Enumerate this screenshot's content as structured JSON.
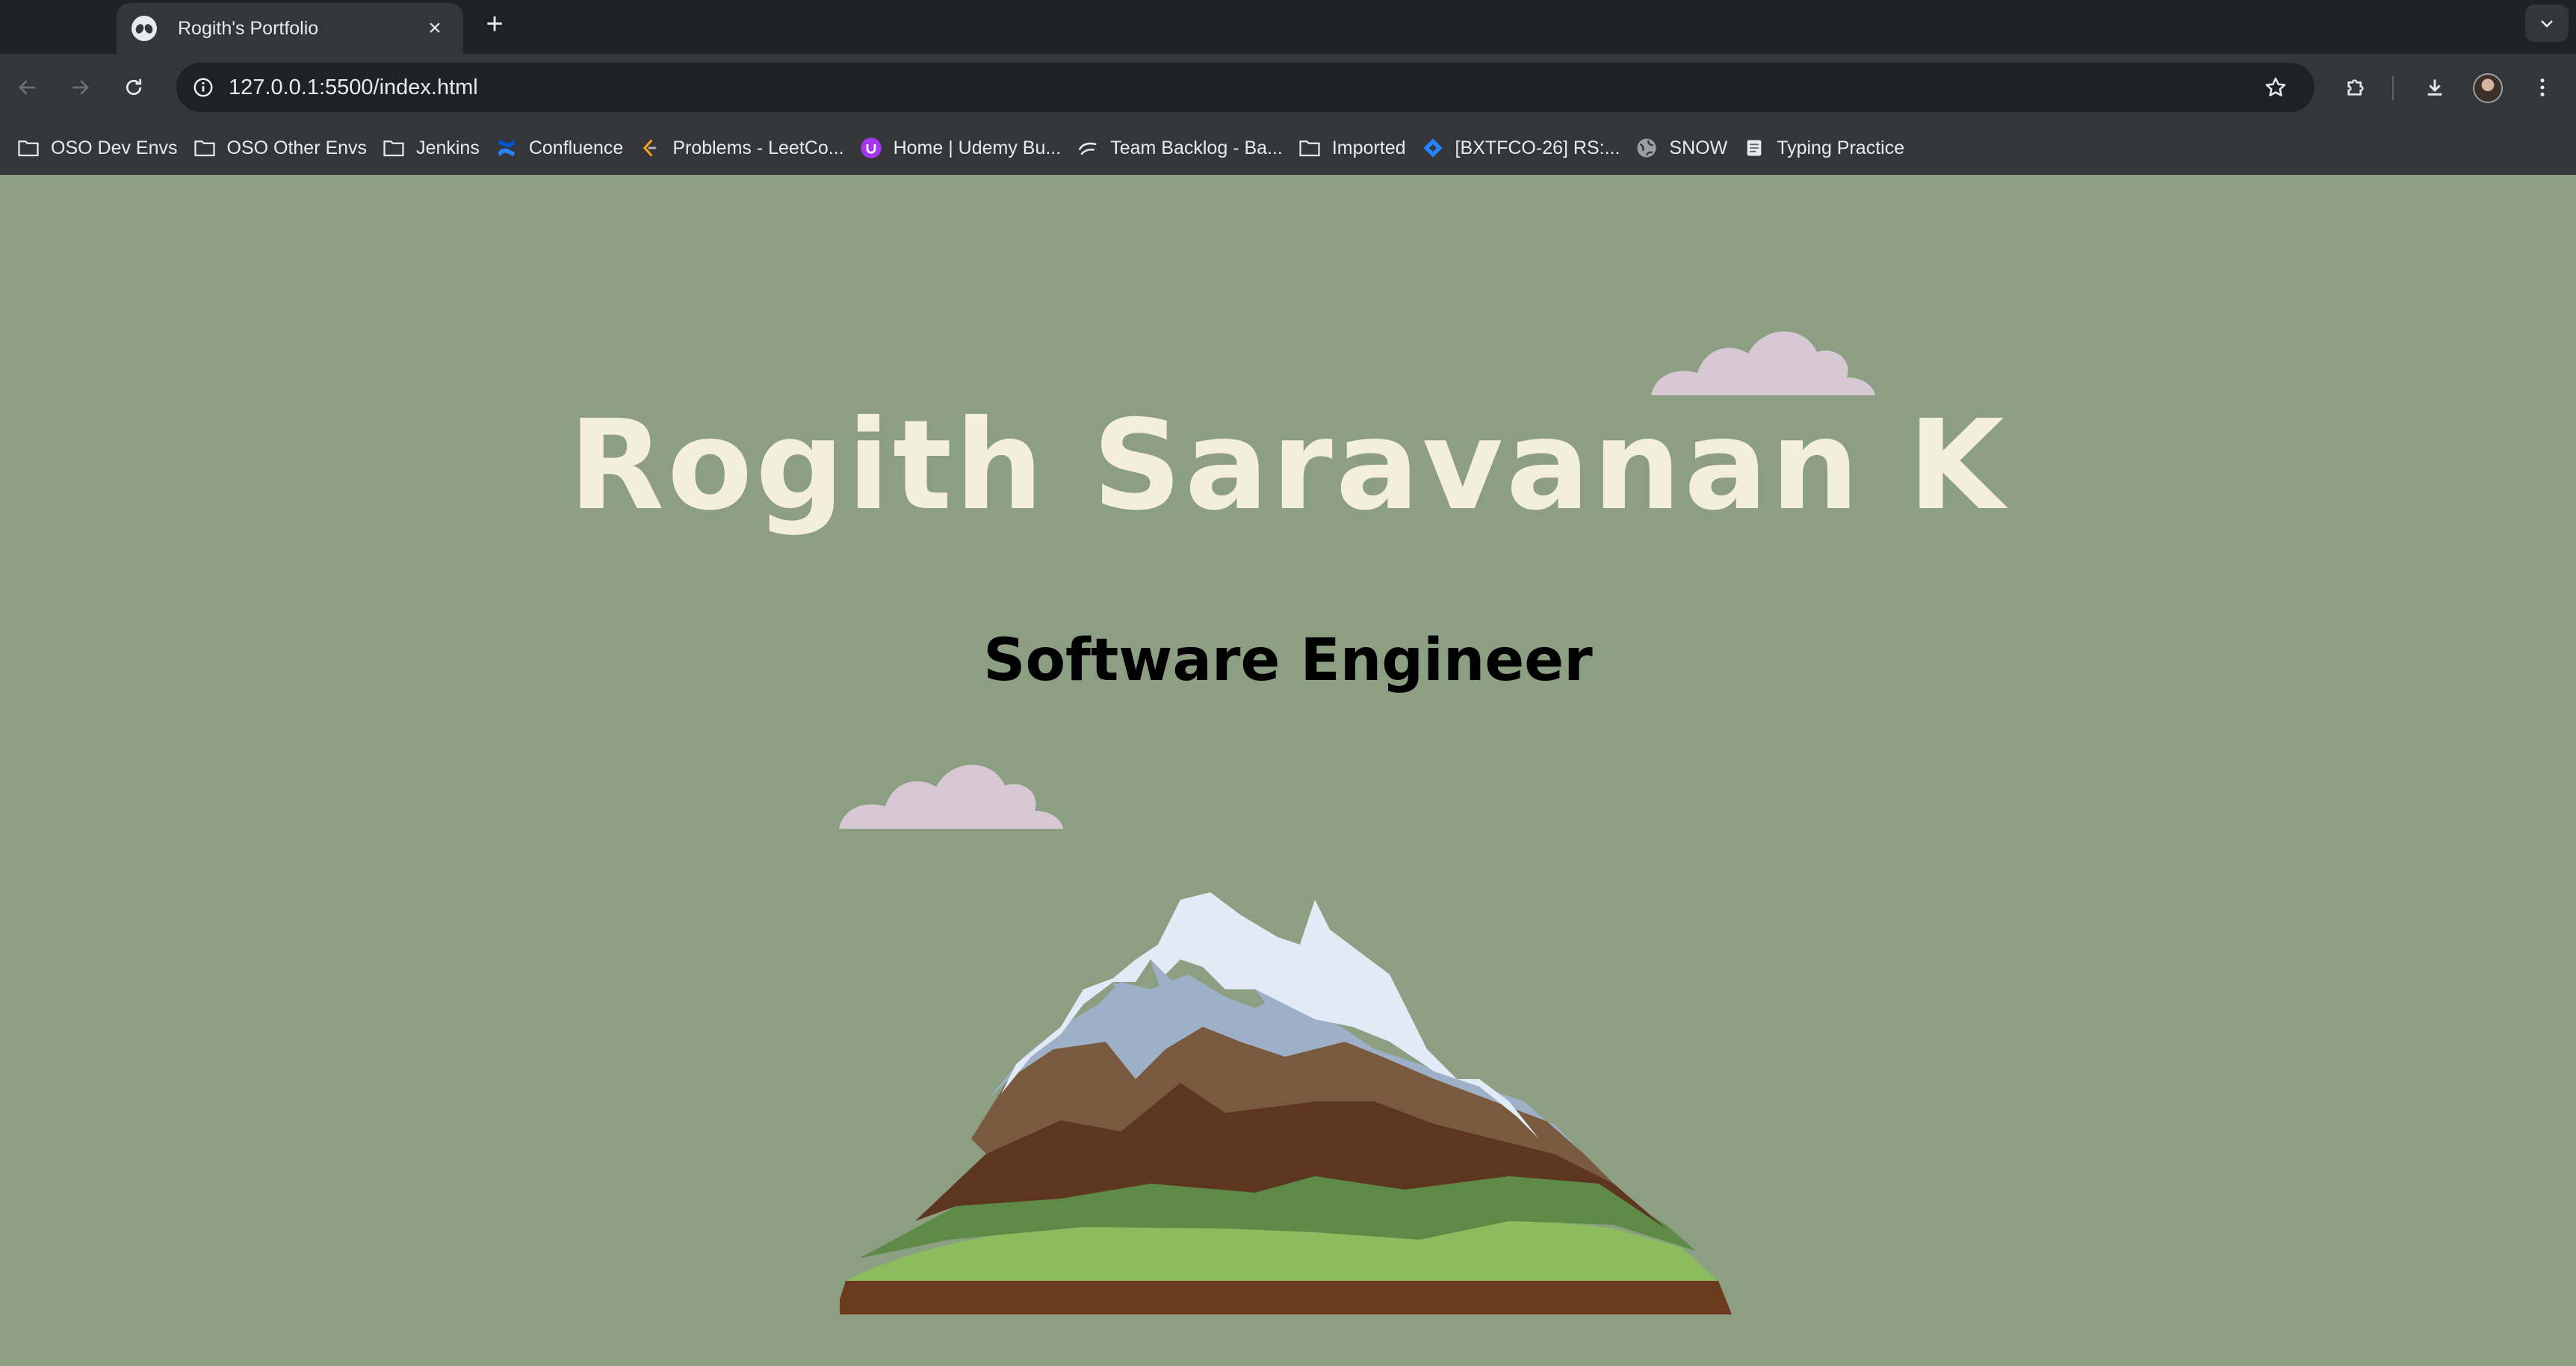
{
  "browser": {
    "tab": {
      "title": "Rogith's Portfolio",
      "favicon": "alien-icon"
    },
    "new_tab_label": "+",
    "address": {
      "url": "127.0.0.1:5500/index.html"
    },
    "bookmarks": [
      {
        "label": "OSO Dev Envs",
        "icon": "folder-icon"
      },
      {
        "label": "OSO Other Envs",
        "icon": "folder-icon"
      },
      {
        "label": "Jenkins",
        "icon": "folder-icon"
      },
      {
        "label": "Confluence",
        "icon": "confluence-icon"
      },
      {
        "label": "Problems - LeetCo...",
        "icon": "leetcode-icon"
      },
      {
        "label": "Home | Udemy Bu...",
        "icon": "udemy-icon"
      },
      {
        "label": "Team Backlog - Ba...",
        "icon": "backlog-icon"
      },
      {
        "label": "Imported",
        "icon": "folder-icon"
      },
      {
        "label": "[BXTFCO-26] RS:...",
        "icon": "jira-icon"
      },
      {
        "label": "SNOW",
        "icon": "globe-icon"
      },
      {
        "label": "Typing Practice",
        "icon": "document-icon"
      }
    ]
  },
  "page": {
    "name": "Rogith Saravanan K",
    "title": "Software Engineer",
    "background_color": "#8c9f83",
    "name_color": "#f3efdc",
    "cloud_color": "#d8c8d3"
  }
}
